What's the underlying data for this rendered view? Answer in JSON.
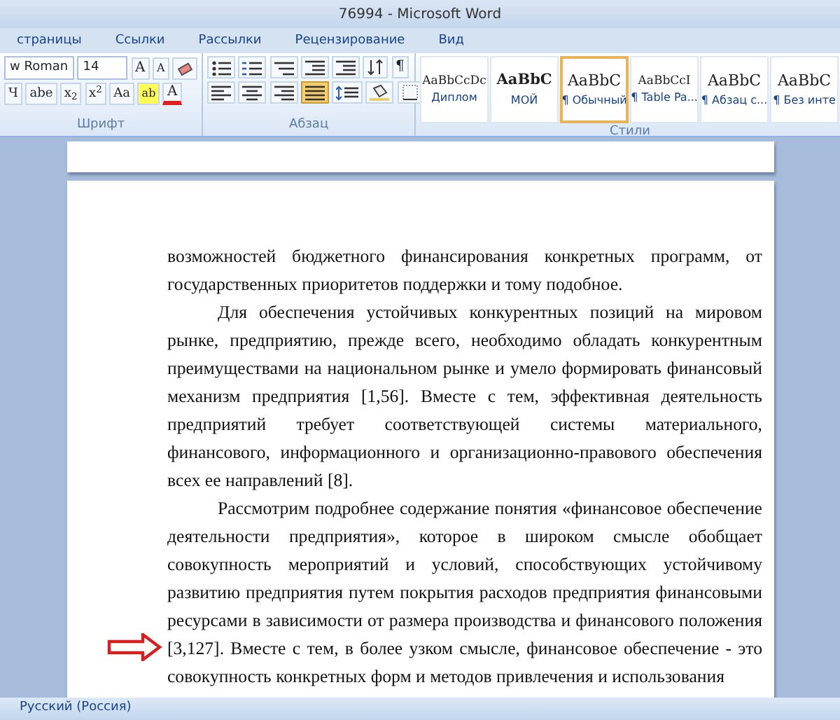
{
  "window": {
    "title": "76994 - Microsoft Word"
  },
  "tabs": [
    {
      "label": "страницы",
      "selected": false
    },
    {
      "label": "Ссылки",
      "selected": false
    },
    {
      "label": "Рассылки",
      "selected": false
    },
    {
      "label": "Рецензирование",
      "selected": false
    },
    {
      "label": "Вид",
      "selected": false
    }
  ],
  "font_group": {
    "font_name": "w Roman",
    "font_size": "14",
    "grow_label": "A",
    "shrink_label": "A",
    "format_buttons": [
      "Ч",
      "abe",
      "x$_{2}$",
      "x$^{2}$",
      "Aa"
    ],
    "highlight_label": "ab",
    "color_label": "A",
    "title": "Шрифт"
  },
  "paragraph_group": {
    "pilcrow": "¶",
    "alignment": [
      {
        "kind": "left",
        "selected": false
      },
      {
        "kind": "center",
        "selected": false
      },
      {
        "kind": "right",
        "selected": false
      },
      {
        "kind": "justify",
        "selected": true
      }
    ],
    "title": "Абзац"
  },
  "styles_group": {
    "title": "Стили",
    "styles": [
      {
        "sample": "AaBbCcDc",
        "name": "Диплом",
        "kind": "small",
        "selected": false
      },
      {
        "sample": "AaBbC",
        "name": "МОЙ",
        "kind": "bold",
        "selected": false
      },
      {
        "sample": "AaBbC",
        "name": "¶ Обычный",
        "kind": "large",
        "selected": true
      },
      {
        "sample": "AaBbCcI",
        "name": "¶ Table Pa...",
        "kind": "small",
        "selected": false
      },
      {
        "sample": "AaBbC",
        "name": "¶ Абзац с...",
        "kind": "large",
        "selected": false
      },
      {
        "sample": "AaBbC",
        "name": "¶ Без инте",
        "kind": "large",
        "selected": false
      }
    ]
  },
  "document": {
    "paragraphs": [
      {
        "continued": true,
        "lines": [
          "возможностей бюджетного финансирования конкретных программ, от",
          "государственных приоритетов поддержки и тому подобное."
        ]
      },
      {
        "continued": false,
        "lines": [
          "Для обеспечения устойчивых конкурентных позиций на мировом",
          "рынке, предприятию, прежде всего, необходимо обладать конкурентным",
          "преимуществами на национальном рынке и умело формировать финансовый",
          "механизм предприятия [1,56]. Вместе с тем, эффективная деятельность",
          "предприятий требует соответствующей системы материального,",
          "финансового, информационного и организационно-правового обеспечения",
          "всех ее направлений [8]."
        ]
      },
      {
        "continued": false,
        "lines": [
          "Рассмотрим подробнее содержание понятия «финансовое обеспечение",
          "деятельности предприятия», которое в широком смысле обобщает",
          "совокупность мероприятий и условий, способствующих устойчивому",
          "развитию предприятия путем покрытия расходов предприятия финансовыми",
          "ресурсами в зависимости от размера производства и финансового положения",
          "[3,127]. Вместе с тем, в более узком смысле, финансовое обеспечение - это",
          "совокупность конкретных форм и методов привлечения и использования"
        ]
      }
    ]
  },
  "status_bar": {
    "language": "Русский (Россия)"
  }
}
